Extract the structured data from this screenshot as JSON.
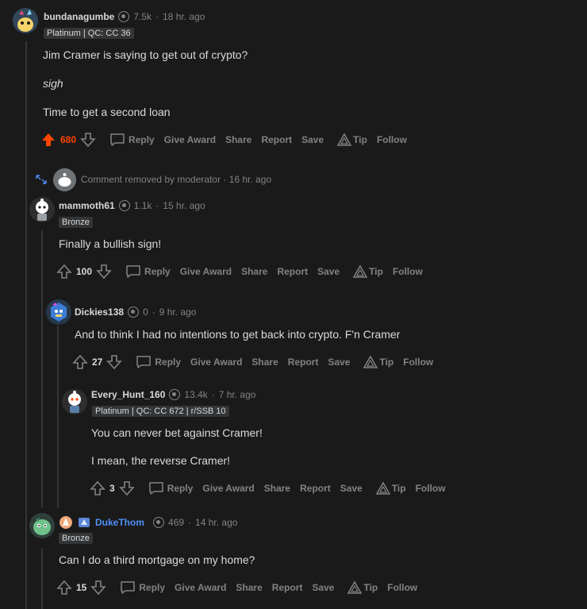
{
  "comments": [
    {
      "username": "bundanagumbe",
      "karma": "7.5k",
      "time": "18 hr. ago",
      "flair": "Platinum | QC: CC 36",
      "body": [
        "Jim Cramer is saying to get out of crypto?",
        "sigh",
        "Time to get a second loan"
      ],
      "score": "680"
    },
    {
      "removed": "Comment removed by moderator",
      "time": "16 hr. ago"
    },
    {
      "username": "mammoth61",
      "karma": "1.1k",
      "time": "15 hr. ago",
      "flair": "Bronze",
      "body": [
        "Finally a bullish sign!"
      ],
      "score": "100"
    },
    {
      "username": "Dickies138",
      "karma": "0",
      "time": "9 hr. ago",
      "body": [
        "And to think I had no intentions to get back into crypto. F'n Cramer"
      ],
      "score": "27"
    },
    {
      "username": "Every_Hunt_160",
      "karma": "13.4k",
      "time": "7 hr. ago",
      "flair": "Platinum | QC: CC 672 | r/SSB 10",
      "body": [
        "You can never bet against Cramer!",
        "I mean, the reverse Cramer!"
      ],
      "score": "3"
    },
    {
      "username": "DukeThom",
      "karma": "469",
      "time": "14 hr. ago",
      "flair": "Bronze",
      "body": [
        "Can I do a third mortgage on my home?"
      ],
      "score": "15"
    }
  ],
  "actions": {
    "reply": "Reply",
    "give_award": "Give Award",
    "share": "Share",
    "report": "Report",
    "save": "Save",
    "tip": "Tip",
    "follow": "Follow"
  },
  "separator": "·",
  "colors": {
    "background": "#1a1a1b",
    "upvote": "#ff4500",
    "link_user": "#4f8ff7"
  }
}
